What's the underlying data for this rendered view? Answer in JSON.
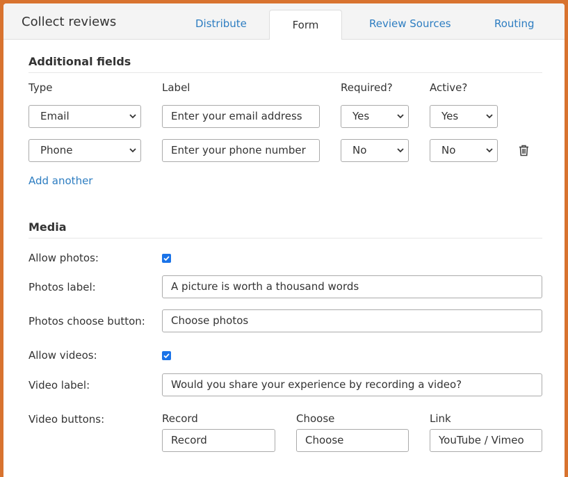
{
  "header": {
    "title": "Collect reviews",
    "tabs": [
      "Distribute",
      "Form",
      "Review Sources",
      "Routing"
    ],
    "active_tab": "Form"
  },
  "additional_fields": {
    "title": "Additional fields",
    "columns": {
      "type": "Type",
      "label": "Label",
      "required": "Required?",
      "active": "Active?"
    },
    "rows": [
      {
        "type": "Email",
        "label": "Enter your email address",
        "required": "Yes",
        "active": "Yes"
      },
      {
        "type": "Phone",
        "label": "Enter your phone number",
        "required": "No",
        "active": "No"
      }
    ],
    "add_another": "Add another"
  },
  "media": {
    "title": "Media",
    "allow_photos_label": "Allow photos:",
    "allow_photos": true,
    "photos_label_label": "Photos label:",
    "photos_label_value": "A picture is worth a thousand words",
    "photos_choose_label": "Photos choose button:",
    "photos_choose_value": "Choose photos",
    "allow_videos_label": "Allow videos:",
    "allow_videos": true,
    "video_label_label": "Video label:",
    "video_label_value": "Would you share your experience by recording a video?",
    "video_buttons_label": "Video buttons:",
    "video_buttons": {
      "record_header": "Record",
      "record_value": "Record",
      "choose_header": "Choose",
      "choose_value": "Choose",
      "link_header": "Link",
      "link_value": "YouTube / Vimeo"
    }
  },
  "colors": {
    "accent": "#2d7dc1",
    "frame": "#d8732f",
    "checkbox": "#1a73e8"
  }
}
